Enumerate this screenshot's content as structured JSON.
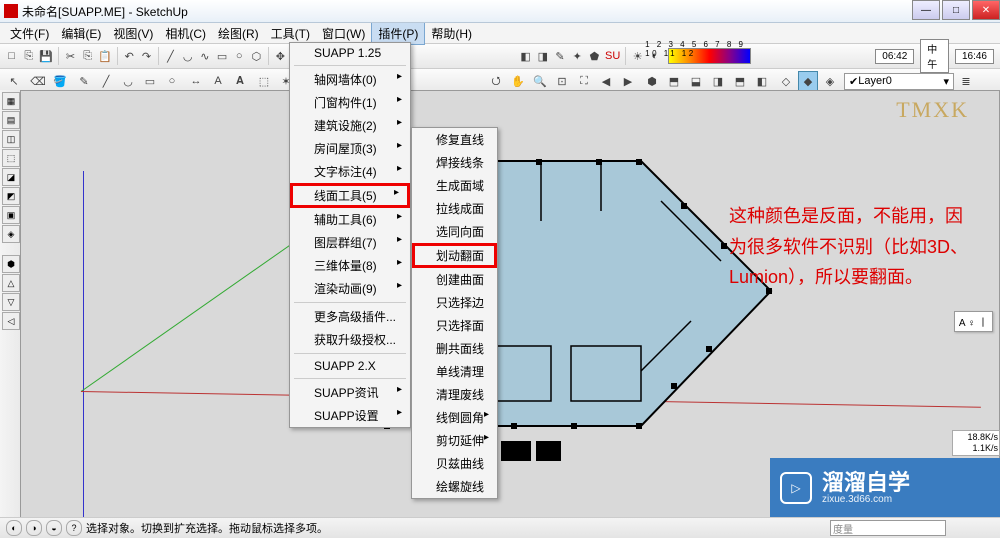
{
  "title": "未命名[SUAPP.ME] - SketchUp",
  "menubar": [
    "文件(F)",
    "编辑(E)",
    "视图(V)",
    "相机(C)",
    "绘图(R)",
    "工具(T)",
    "窗口(W)",
    "插件(P)",
    "帮助(H)"
  ],
  "active_menu_index": 7,
  "toolbar1_times": {
    "t1": "06:42",
    "t2": "中午",
    "t3": "16:46"
  },
  "gradient_labels": "1 2 3 4 5 6 7 8 9 10 11 12",
  "layer": {
    "checked": true,
    "name": "Layer0"
  },
  "menu1": {
    "top": "SUAPP 1.25",
    "items": [
      {
        "label": "轴网墙体(0)",
        "arrow": true
      },
      {
        "label": "门窗构件(1)",
        "arrow": true
      },
      {
        "label": "建筑设施(2)",
        "arrow": true
      },
      {
        "label": "房间屋顶(3)",
        "arrow": true
      },
      {
        "label": "文字标注(4)",
        "arrow": true
      },
      {
        "label": "线面工具(5)",
        "arrow": true,
        "highlight": true
      },
      {
        "label": "辅助工具(6)",
        "arrow": true
      },
      {
        "label": "图层群组(7)",
        "arrow": true
      },
      {
        "label": "三维体量(8)",
        "arrow": true
      },
      {
        "label": "渲染动画(9)",
        "arrow": true
      }
    ],
    "mid": [
      "更多高级插件...",
      "获取升级授权..."
    ],
    "suapp2": "SUAPP 2.X",
    "bottom": [
      "SUAPP资讯",
      "SUAPP设置"
    ]
  },
  "menu2": {
    "items": [
      {
        "label": "修复直线"
      },
      {
        "label": "焊接线条"
      },
      {
        "label": "生成面域"
      },
      {
        "label": "拉线成面"
      },
      {
        "label": "选同向面"
      },
      {
        "label": "划动翻面",
        "highlight": true
      },
      {
        "label": "创建曲面"
      },
      {
        "label": "只选择边"
      },
      {
        "label": "只选择面"
      },
      {
        "label": "删共面线"
      },
      {
        "label": "单线清理"
      },
      {
        "label": "清理废线"
      },
      {
        "label": "线倒圆角",
        "arrow": true
      },
      {
        "label": "剪切延伸",
        "arrow": true
      },
      {
        "label": "贝兹曲线"
      },
      {
        "label": "绘螺旋线"
      }
    ]
  },
  "watermark": "TMXK",
  "annotation": "这种颜色是反面，不能用，因为很多软件不识别（比如3D、Lumion），所以要翻面。",
  "statusbar": {
    "text": "选择对象。切换到扩充选择。拖动鼠标选择多项。",
    "dim_label": "度量"
  },
  "smallpanel": "A ♀ 丨",
  "badge": {
    "main": "溜溜自学",
    "sub": "zixue.3d66.com"
  },
  "speed": {
    "down": "18.8K/s",
    "up": "1.1K/s"
  },
  "icons": {
    "arrow": "↖",
    "pencil": "✎",
    "rect": "▭",
    "circle": "○",
    "arc": "◡",
    "eraser": "⌫",
    "bucket": "🪣",
    "tape": "📏",
    "move": "✥",
    "rotate": "⟲",
    "scale": "⤢",
    "offset": "◎",
    "push": "⇧",
    "orbit": "⭯",
    "pan": "✋",
    "zoom": "🔍"
  }
}
